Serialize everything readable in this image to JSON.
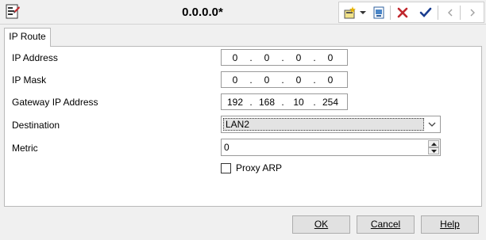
{
  "window": {
    "title": "0.0.0.0*"
  },
  "tabs": [
    {
      "label": "IP Route"
    }
  ],
  "form": {
    "ip_address": {
      "label": "IP Address",
      "octets": [
        "0",
        "0",
        "0",
        "0"
      ]
    },
    "ip_mask": {
      "label": "IP Mask",
      "octets": [
        "0",
        "0",
        "0",
        "0"
      ]
    },
    "gateway": {
      "label": "Gateway IP Address",
      "octets": [
        "192",
        "168",
        "10",
        "254"
      ]
    },
    "destination": {
      "label": "Destination",
      "value": "LAN2"
    },
    "metric": {
      "label": "Metric",
      "value": "0"
    },
    "proxy_arp": {
      "label": "Proxy ARP",
      "checked": false
    }
  },
  "buttons": {
    "ok": "OK",
    "cancel": "Cancel",
    "help": "Help"
  },
  "toolbar": {
    "icons": [
      "new-icon",
      "dropdown-arrow-icon",
      "export-icon",
      "delete-icon",
      "confirm-icon",
      "previous-icon",
      "next-icon"
    ]
  },
  "colors": {
    "delete_red": "#c0272d",
    "confirm_blue": "#1a3d8f",
    "disabled_gray": "#a0a0a0"
  }
}
